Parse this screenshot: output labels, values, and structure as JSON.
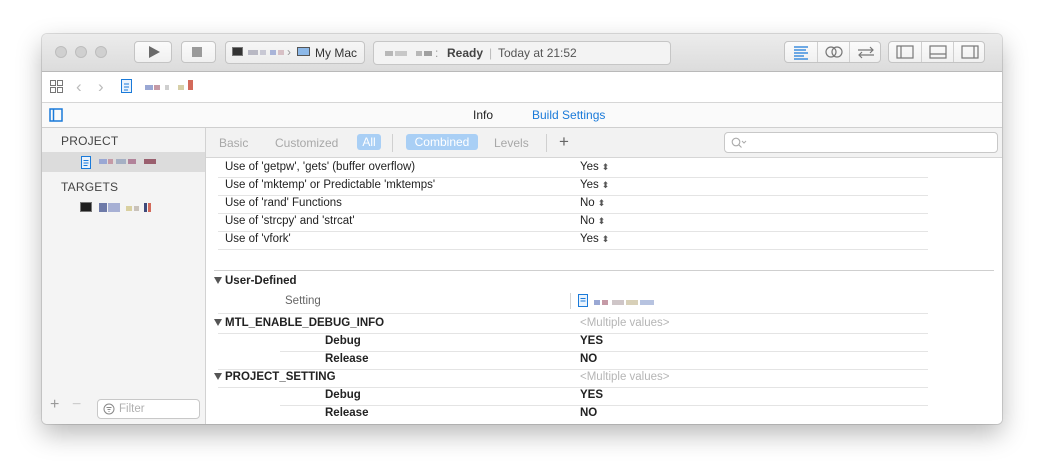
{
  "toolbar": {
    "destination_label": "My Mac",
    "status_text": "Ready",
    "status_time": "Today at 21:52"
  },
  "tabs": {
    "info": "Info",
    "build_settings": "Build Settings"
  },
  "left_panel": {
    "project_header": "PROJECT",
    "targets_header": "TARGETS",
    "filter_placeholder": "Filter"
  },
  "filter_bar": {
    "basic": "Basic",
    "customized": "Customized",
    "all": "All",
    "combined": "Combined",
    "levels": "Levels",
    "add": "+"
  },
  "settings_rows": [
    {
      "label": "Use of 'getpw', 'gets' (buffer overflow)",
      "value": "Yes"
    },
    {
      "label": "Use of 'mktemp' or Predictable 'mktemps'",
      "value": "Yes"
    },
    {
      "label": "Use of 'rand' Functions",
      "value": "No"
    },
    {
      "label": "Use of 'strcpy' and 'strcat'",
      "value": "No"
    },
    {
      "label": "Use of 'vfork'",
      "value": "Yes"
    }
  ],
  "user_defined": {
    "section_title": "User-Defined",
    "setting_header": "Setting",
    "items": [
      {
        "name": "MTL_ENABLE_DEBUG_INFO",
        "summary": "<Multiple values>",
        "debug_label": "Debug",
        "debug_value": "YES",
        "release_label": "Release",
        "release_value": "NO"
      },
      {
        "name": "PROJECT_SETTING",
        "summary": "<Multiple values>",
        "debug_label": "Debug",
        "debug_value": "YES",
        "release_label": "Release",
        "release_value": "NO"
      }
    ]
  },
  "colors": {
    "accent": "#1a7ad9",
    "selection": "#dcdcdc",
    "pill": "#a9cff5"
  }
}
